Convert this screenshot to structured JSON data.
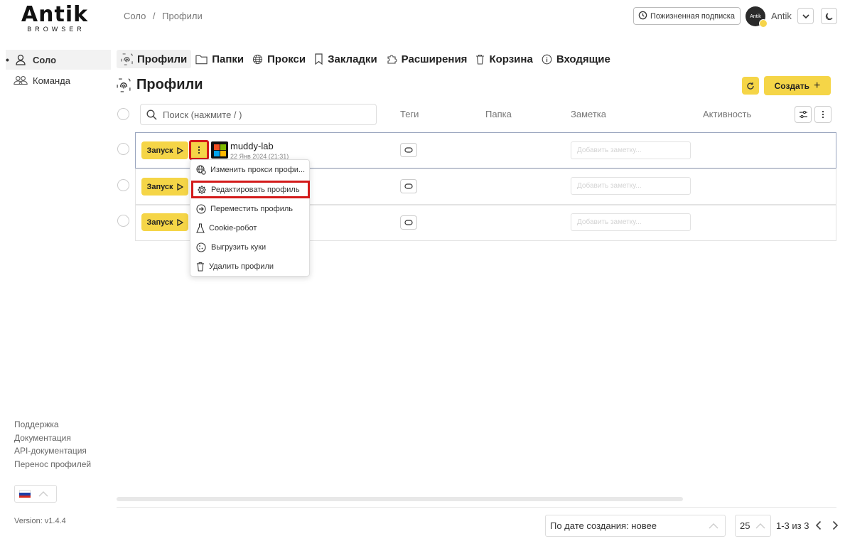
{
  "logo": {
    "main": "Antik",
    "sub": "BROWSER"
  },
  "breadcrumb": {
    "root": "Соло",
    "sep": "/",
    "current": "Профили"
  },
  "header": {
    "subscription": "Пожизненная подписка",
    "avatar_text": "Antik",
    "user_name": "Antik"
  },
  "sidebar": {
    "items": [
      {
        "label": "Соло",
        "active": true
      },
      {
        "label": "Команда",
        "active": false
      }
    ],
    "links": [
      "Поддержка",
      "Документация",
      "API-документация",
      "Перенос профилей"
    ],
    "version": "Version: v1.4.4"
  },
  "tabs": [
    {
      "label": "Профили",
      "icon": "fingerprint-icon",
      "active": true
    },
    {
      "label": "Папки",
      "icon": "folder-icon"
    },
    {
      "label": "Прокси",
      "icon": "globe-icon"
    },
    {
      "label": "Закладки",
      "icon": "bookmark-icon"
    },
    {
      "label": "Расширения",
      "icon": "puzzle-icon"
    },
    {
      "label": "Корзина",
      "icon": "trash-icon"
    },
    {
      "label": "Входящие",
      "icon": "info-icon"
    }
  ],
  "page": {
    "title": "Профили",
    "create_label": "Создать",
    "search_placeholder": "Поиск (нажмите / )"
  },
  "columns": {
    "tags": "Теги",
    "folder": "Папка",
    "note": "Заметка",
    "activity": "Активность"
  },
  "rows": [
    {
      "launch": "Запуск",
      "name": "muddy-lab",
      "date": "22 Янв 2024 (21:31)",
      "note_placeholder": "Добавить заметку..."
    },
    {
      "launch": "Запуск",
      "note_placeholder": "Добавить заметку..."
    },
    {
      "launch": "Запуск",
      "note_placeholder": "Добавить заметку..."
    }
  ],
  "context_menu": [
    {
      "label": "Изменить прокси профи...",
      "icon": "globe-gear-icon"
    },
    {
      "label": "Редактировать профиль",
      "icon": "gear-icon",
      "highlighted": true
    },
    {
      "label": "Переместить профиль",
      "icon": "arrow-circle-icon"
    },
    {
      "label": "Cookie-робот",
      "icon": "flask-icon"
    },
    {
      "label": "Выгрузить куки",
      "icon": "cookie-icon"
    },
    {
      "label": "Удалить профили",
      "icon": "trash-icon"
    }
  ],
  "footer": {
    "sort": "По дате создания: новее",
    "page_size": "25",
    "page_info": "1-3 из 3"
  },
  "colors": {
    "accent": "#f5d547",
    "highlight": "#d31a1a"
  }
}
